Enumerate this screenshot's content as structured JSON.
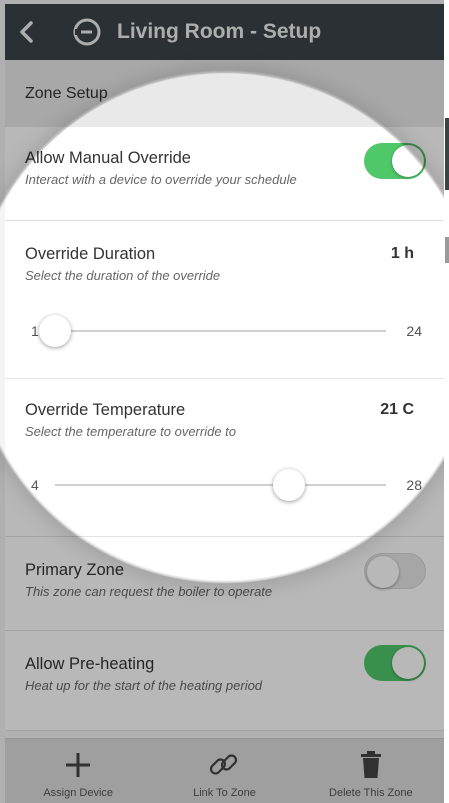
{
  "header": {
    "title": "Living Room - Setup"
  },
  "section": {
    "title": "Zone Setup"
  },
  "settings": {
    "manual_override": {
      "title": "Allow Manual Override",
      "subtitle": "Interact with a device to override your schedule",
      "enabled": true
    },
    "override_duration": {
      "title": "Override Duration",
      "subtitle": "Select the duration of the override",
      "value_label": "1 h",
      "min_label": "1",
      "max_label": "24",
      "min": 1,
      "max": 24,
      "value": 1
    },
    "override_temperature": {
      "title": "Override Temperature",
      "subtitle": "Select the temperature to override to",
      "value_label": "21 C",
      "min_label": "4",
      "max_label": "28",
      "min": 4,
      "max": 28,
      "value": 21
    },
    "primary_zone": {
      "title": "Primary Zone",
      "subtitle": "This zone can request the boiler to operate",
      "enabled": false
    },
    "pre_heating": {
      "title": "Allow Pre-heating",
      "subtitle": "Heat up for the start of the heating period",
      "enabled": true
    }
  },
  "bottom_bar": {
    "assign_device": "Assign Device",
    "link_to_zone": "Link To Zone",
    "delete_zone": "Delete This Zone"
  },
  "colors": {
    "header_bg": "#3a4347",
    "toggle_on": "#4fc86a",
    "toggle_off": "#e6e6e6"
  },
  "icons": [
    "back-chevron-icon",
    "app-logo-icon",
    "plus-icon",
    "link-icon",
    "trash-icon"
  ]
}
